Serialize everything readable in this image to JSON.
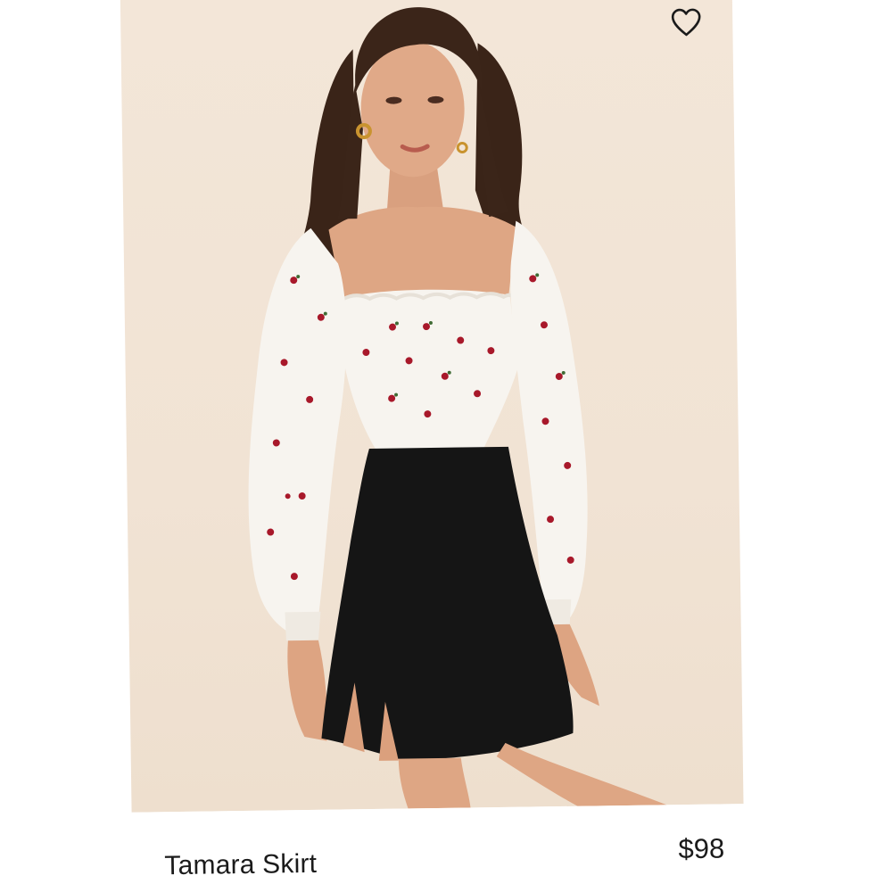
{
  "product": {
    "name": "Tamara Skirt",
    "price": "$98"
  },
  "icons": {
    "favorite": "heart-outline-icon"
  },
  "colors": {
    "image_background": "#f1e3d4",
    "text": "#1b1b1b",
    "skirt": "#151515",
    "blouse": "#f7f4ef",
    "print_accent": "#a8182a"
  }
}
